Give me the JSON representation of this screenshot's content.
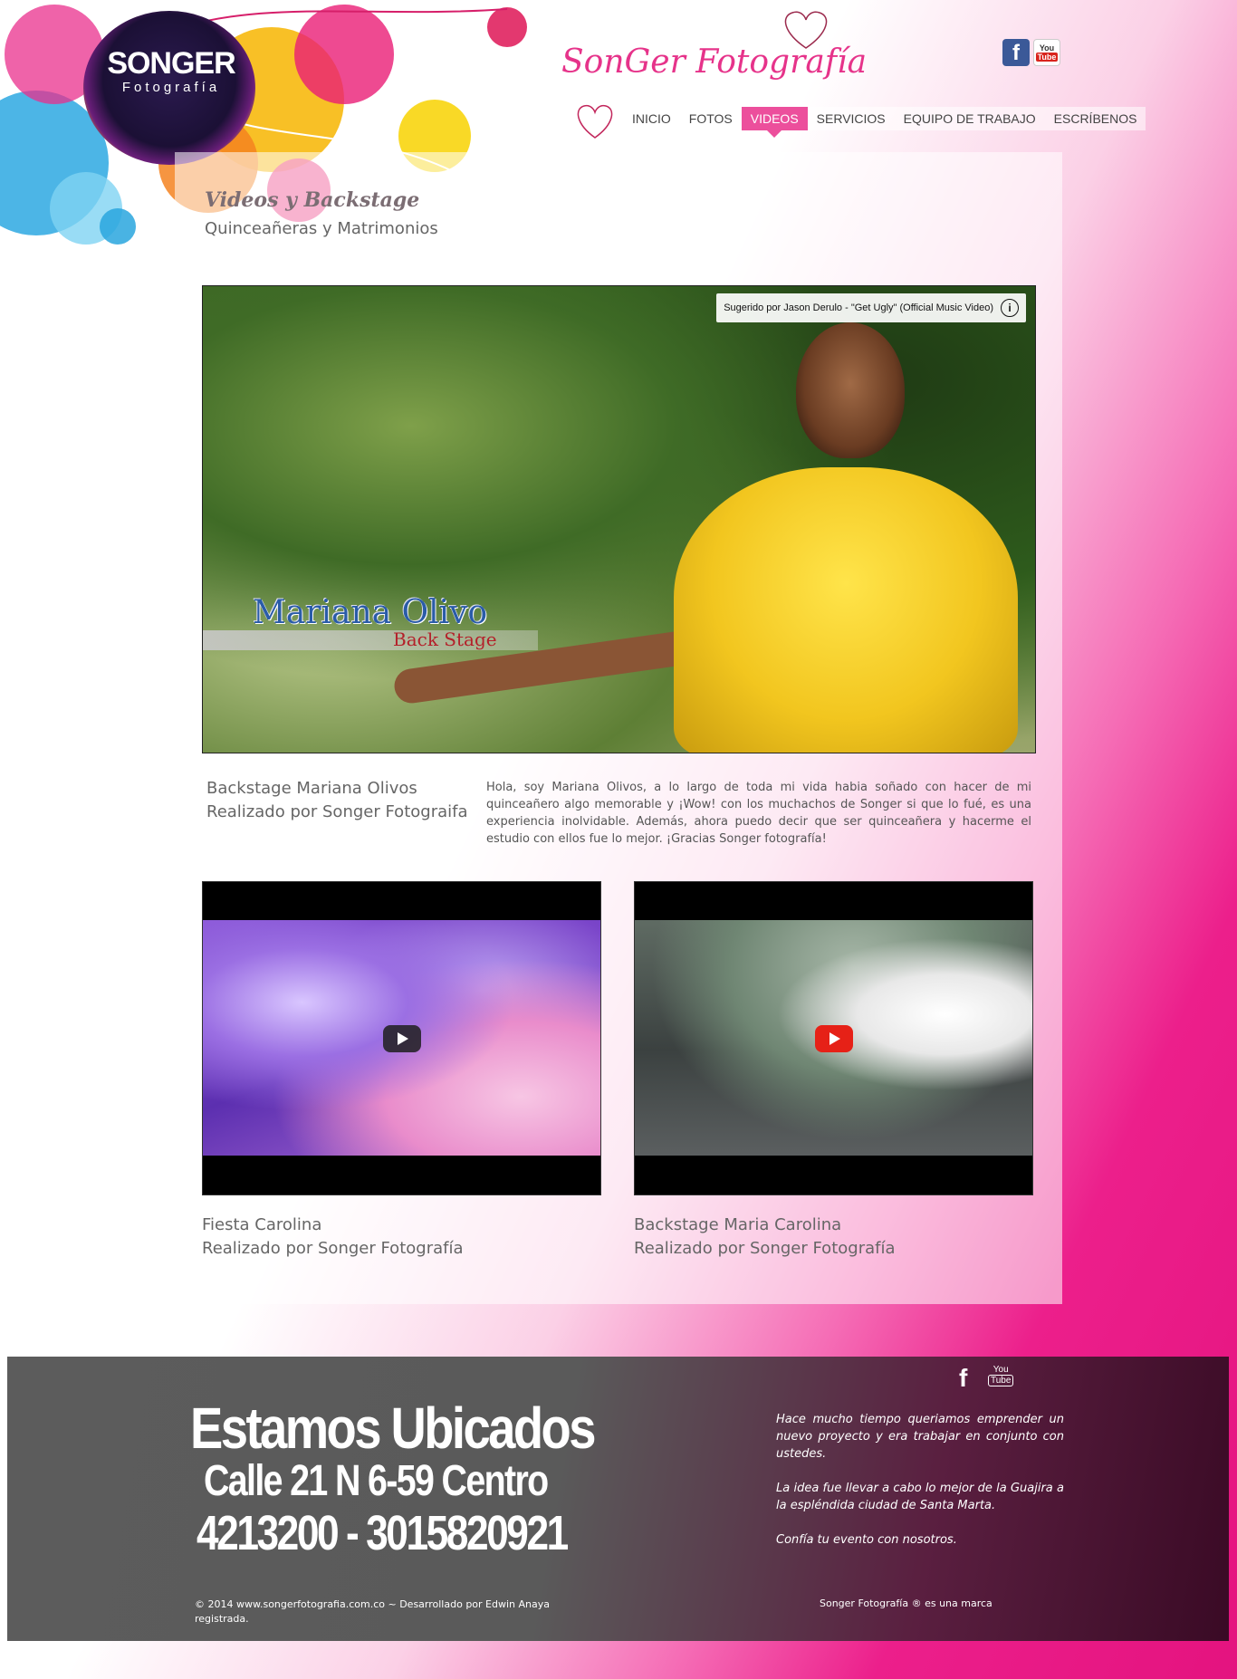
{
  "brand": {
    "logo_title": "SONGER",
    "logo_subtitle": "Fotografía",
    "script_title": "SonGer Fotografía"
  },
  "social": {
    "facebook_label": "f",
    "youtube_top": "You",
    "youtube_bottom": "Tube"
  },
  "nav": {
    "items": [
      {
        "label": "INICIO"
      },
      {
        "label": "FOTOS"
      },
      {
        "label": "VIDEOS"
      },
      {
        "label": "SERVICIOS"
      },
      {
        "label": "EQUIPO DE TRABAJO"
      },
      {
        "label": "ESCRÍBENOS"
      }
    ],
    "active": "VIDEOS"
  },
  "page": {
    "title": "Videos y Backstage",
    "subtitle": "Quinceañeras y Matrimonios"
  },
  "main_video": {
    "suggestion": "Sugerido por Jason Derulo - \"Get Ugly\" (Official Music Video)",
    "overlay_name": "Mariana Olivo",
    "overlay_sub": "Back Stage",
    "caption_line1": "Backstage Mariana Olivos",
    "caption_line2": "Realizado por Songer Fotograifa",
    "description": "Hola, soy Mariana Olivos, a lo largo de toda mi vida habia soñado con hacer de mi quinceañero algo memorable y ¡Wow! con los muchachos de Songer si que lo fué, es una experiencia inolvidable. Además, ahora puedo decir que ser quinceañera y hacerme el estudio con ellos fue lo mejor. ¡Gracias Songer fotografía!"
  },
  "videos": [
    {
      "caption_line1": "Fiesta Carolina",
      "caption_line2": "Realizado por Songer Fotografía"
    },
    {
      "caption_line1": "Backstage Maria Carolina",
      "caption_line2": "Realizado por Songer Fotografía"
    }
  ],
  "footer": {
    "heading": "Estamos Ubicados",
    "address": "Calle 21 N 6-59 Centro",
    "phones": "4213200 - 3015820921",
    "paragraph1": "Hace mucho tiempo queriamos emprender un nuevo proyecto y era trabajar en conjunto con ustedes.",
    "paragraph2": "La idea fue llevar a cabo lo mejor de la Guajira  a la espléndida ciudad de Santa Marta.",
    "paragraph3": "Confía tu evento con nosotros.",
    "copyright": "© 2014 www.songerfotografia.com.co ~ Desarrollado por Edwin Anaya registrada.",
    "brand_note": "Songer Fotografía ® es una marca",
    "facebook_label": "f",
    "youtube_top": "You",
    "youtube_bottom": "Tube"
  },
  "colors": {
    "accent": "#ec4f9c",
    "pink_bg": "#e4137f",
    "footer_gray": "#5a5a5a"
  }
}
